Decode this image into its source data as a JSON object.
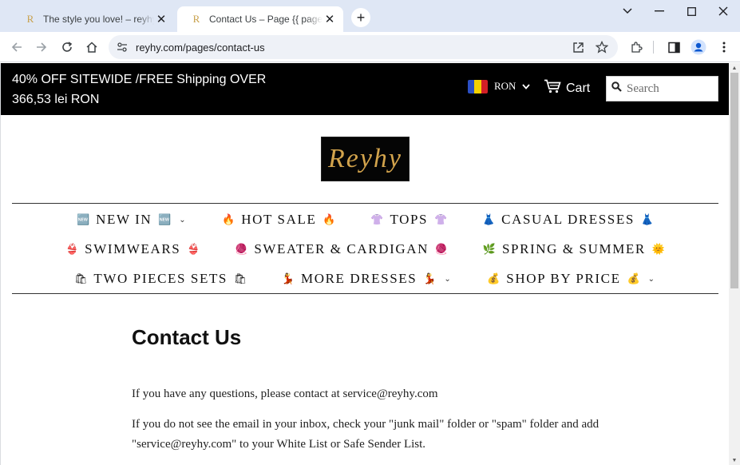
{
  "browser": {
    "tabs": [
      {
        "favicon": "R",
        "title": "The style you love! – reyhy",
        "active": false
      },
      {
        "favicon": "R",
        "title": "Contact Us – Page {{ page }} – reyhy",
        "active": true
      }
    ],
    "new_tab": "+",
    "url": "reyhy.com/pages/contact-us",
    "icons": [
      "back-icon",
      "forward-icon",
      "reload-icon",
      "home-icon",
      "site-info-icon",
      "share-icon",
      "star-icon",
      "extensions-icon",
      "sidepanel-icon",
      "profile-icon",
      "menu-icon",
      "minimize-icon",
      "maximize-icon",
      "close-window-icon",
      "tab-search-icon"
    ]
  },
  "announcement": {
    "text": "40% OFF SITEWIDE /FREE Shipping OVER 366,53 lei RON"
  },
  "header": {
    "currency": "RON",
    "flag_colors": [
      "#2b4fc4",
      "#f5d100",
      "#d21f26"
    ],
    "cart_label": "Cart",
    "search_placeholder": "Search",
    "logo_text": "Reyhy",
    "brand_color": "#d2a34c"
  },
  "nav": {
    "rows": [
      [
        {
          "label": "NEW IN",
          "emoji_left": "🆕",
          "emoji_right": "🆕",
          "dropdown": true
        },
        {
          "label": "HOT SALE",
          "emoji_left": "🔥",
          "emoji_right": "🔥",
          "dropdown": false
        },
        {
          "label": "TOPS",
          "emoji_left": "👚",
          "emoji_right": "👚",
          "dropdown": false
        },
        {
          "label": "CASUAL DRESSES",
          "emoji_left": "👗",
          "emoji_right": "👗",
          "dropdown": false
        }
      ],
      [
        {
          "label": "SWIMWEARS",
          "emoji_left": "👙",
          "emoji_right": "👙",
          "dropdown": false
        },
        {
          "label": "SWEATER & CARDIGAN",
          "emoji_left": "🧶",
          "emoji_right": "🧶",
          "dropdown": false
        },
        {
          "label": "SPRING & SUMMER",
          "emoji_left": "🌿",
          "emoji_right": "🌞",
          "dropdown": false
        }
      ],
      [
        {
          "label": "TWO PIECES SETS",
          "emoji_left": "🛍",
          "emoji_right": "🛍",
          "dropdown": false
        },
        {
          "label": "MORE DRESSES",
          "emoji_left": "💃",
          "emoji_right": "💃",
          "dropdown": true
        },
        {
          "label": "SHOP BY PRICE",
          "emoji_left": "💰",
          "emoji_right": "💰",
          "dropdown": true
        }
      ]
    ]
  },
  "content": {
    "title": "Contact Us",
    "paragraph_1": "If you have any questions, please contact at service@reyhy.com",
    "paragraph_2": "If you do not see the email in your inbox, check your \"junk mail\" folder or \"spam\" folder and add \"service@reyhy.com\" to your White List or Safe Sender List."
  }
}
